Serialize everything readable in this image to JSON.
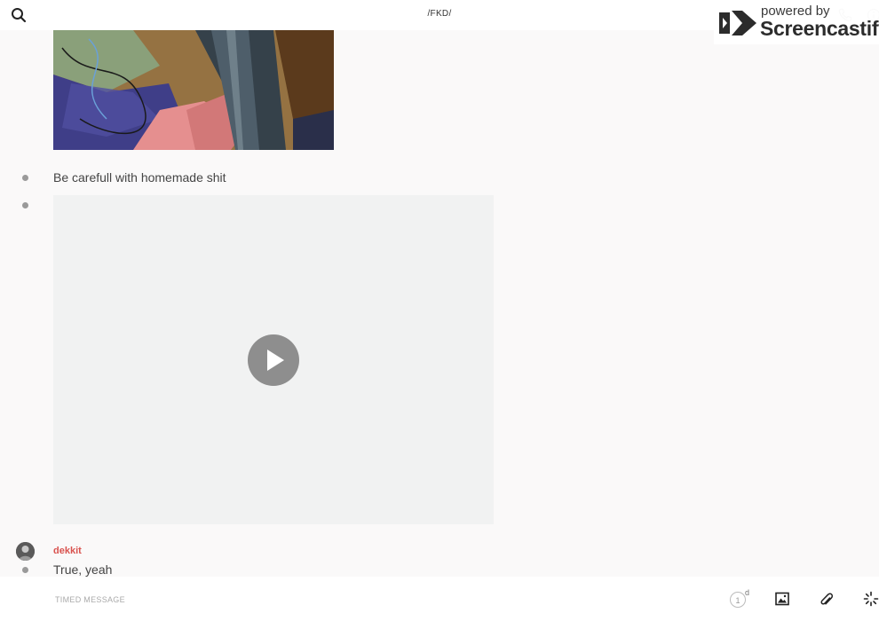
{
  "header": {
    "channel_title": "/FKD/",
    "icons": [
      "search-icon",
      "phone-icon",
      "info-icon"
    ]
  },
  "watermark": {
    "powered_by": "powered by",
    "brand": "Screencastify"
  },
  "messages": [
    {
      "type": "image"
    },
    {
      "type": "text",
      "text": "Be carefull with homemade shit"
    },
    {
      "type": "video",
      "icon": "play-icon"
    },
    {
      "type": "text",
      "author": "dekkit",
      "text": "True, yeah"
    }
  ],
  "composer": {
    "placeholder": "TIMED MESSAGE",
    "timer_value": "1",
    "timer_unit": "d",
    "icons": [
      "timer-icon",
      "image-icon",
      "paperclip-icon",
      "more-icon"
    ]
  },
  "colors": {
    "background": "#faf9f9",
    "author_name": "#d9534f",
    "video_placeholder": "#f1f2f2",
    "play_button": "#8e8e8e"
  }
}
